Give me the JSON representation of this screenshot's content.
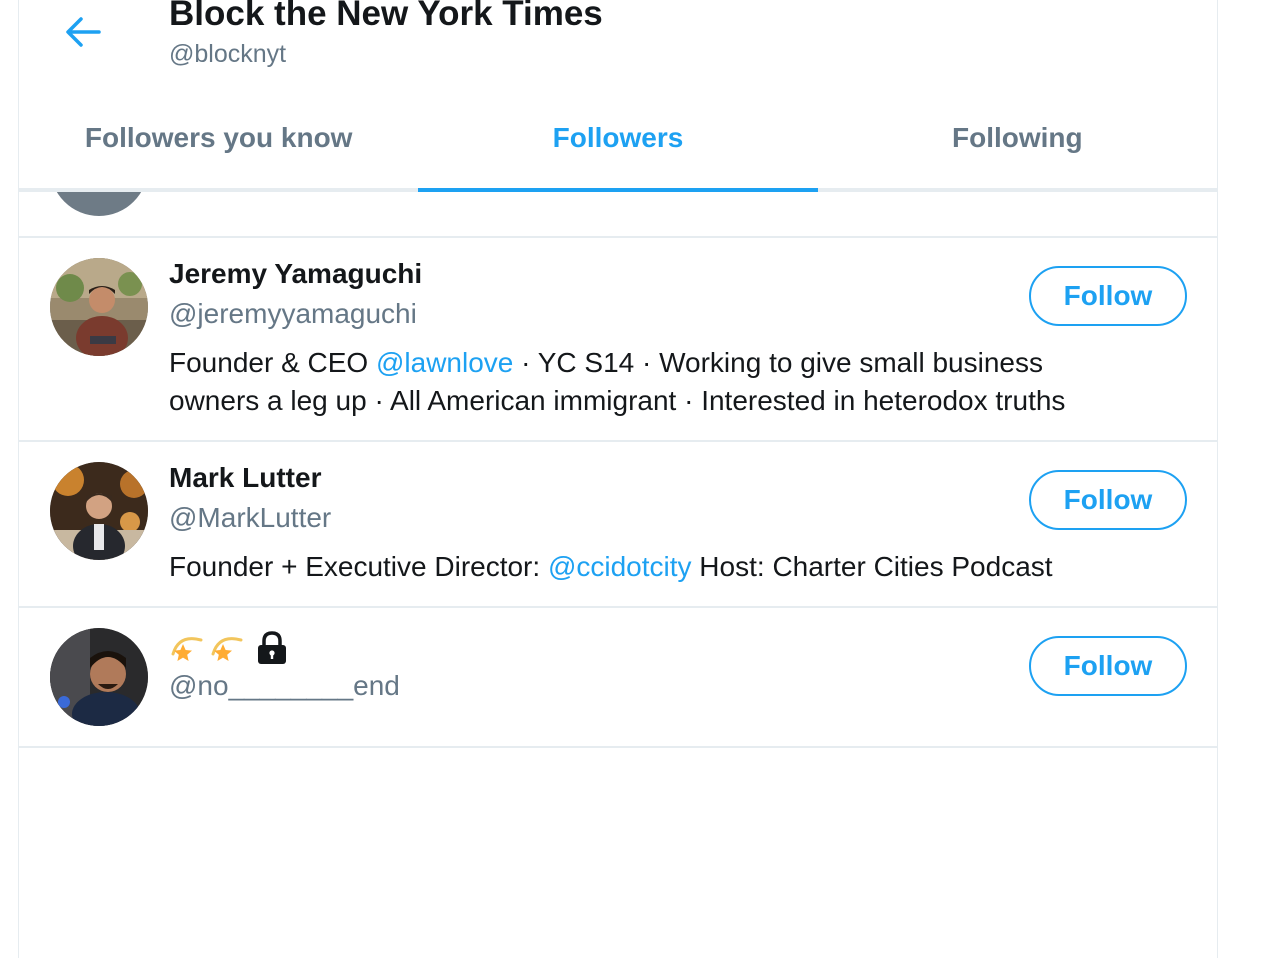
{
  "header": {
    "title": "Block the New York Times",
    "handle": "@blocknyt"
  },
  "tabs": [
    {
      "label": "Followers you know",
      "active": false
    },
    {
      "label": "Followers",
      "active": true
    },
    {
      "label": "Following",
      "active": false
    }
  ],
  "users": [
    {
      "name": "Jeremy Yamaguchi",
      "handle": "@jeremyyamaguchi",
      "bio_line1_a": "Founder & CEO ",
      "bio_line1_mention": "@lawnlove",
      "bio_line1_b": " · YC S14 · Working to give small business",
      "bio_line2": "owners a leg up · All American immigrant · Interested in heterodox truths",
      "follow_label": "Follow"
    },
    {
      "name": "Mark Lutter",
      "handle": "@MarkLutter",
      "bio_a": "Founder + Executive Director: ",
      "bio_mention": "@ccidotcity",
      "bio_b": " Host: Charter Cities Podcast",
      "follow_label": "Follow"
    },
    {
      "name_icons": [
        "dizzy-emoji",
        "dizzy-emoji",
        "lock-icon"
      ],
      "handle": "@no________end",
      "follow_label": "Follow"
    }
  ],
  "colors": {
    "accent": "#1da1f2",
    "text_primary": "#14171a",
    "text_secondary": "#657786",
    "border": "#e6ecf0"
  }
}
